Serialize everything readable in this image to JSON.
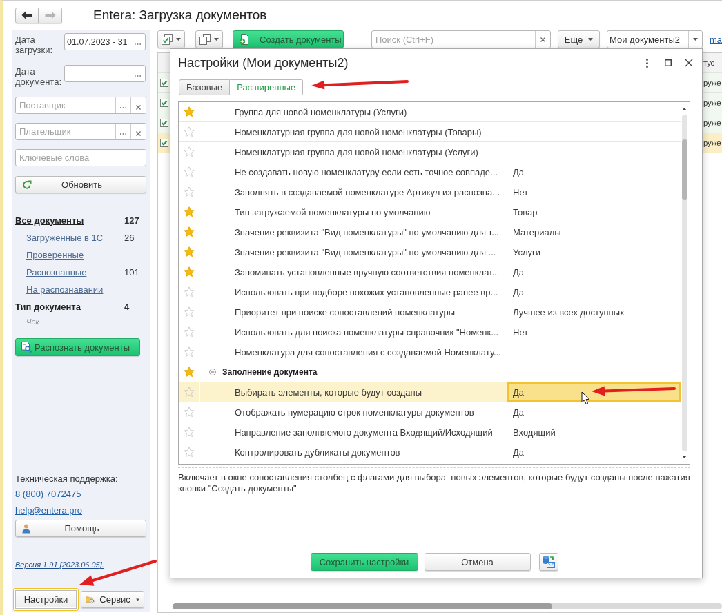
{
  "window": {
    "title": "Entera: Загрузка документов"
  },
  "navigation": {
    "back": {
      "disabled": false
    },
    "forward": {
      "disabled": true
    }
  },
  "filters": {
    "upload_date": {
      "label": "Дата загрузки:",
      "value": "01.07.2023 - 31"
    },
    "document_date": {
      "label": "Дата документа:"
    },
    "supplier": {
      "placeholder": "Поставщик"
    },
    "payer": {
      "placeholder": "Плательщик"
    },
    "keywords": {
      "placeholder": "Ключевые слова"
    },
    "refresh_button": "Обновить"
  },
  "document_groups": [
    {
      "label": "Все документы",
      "count": "127",
      "children": [
        {
          "label": "Загруженные в 1С",
          "count": "26",
          "kind": "link"
        },
        {
          "label": "Проверенные",
          "kind": "link"
        },
        {
          "label": "Распознанные",
          "count": "101",
          "kind": "link"
        },
        {
          "label": "На распознавании",
          "kind": "link"
        }
      ]
    },
    {
      "label": "Тип документа",
      "count": "4",
      "children": [
        {
          "label": "Чек",
          "kind": "note"
        }
      ]
    }
  ],
  "recognize_button": "Распознать документы",
  "support": {
    "label": "Техническая поддержка:",
    "phone": "8 (800) 7072475",
    "email": "help@entera.pro"
  },
  "help_button": "Помощь",
  "version": "Версия 1.91 [2023.06.05].",
  "bottom_buttons": [
    {
      "label": "Настройки",
      "kind": "plain",
      "focused": true
    },
    {
      "label": "Сервис",
      "kind": "menu",
      "focused": false
    }
  ],
  "toolbar": {
    "create_button": "Создать документы",
    "search": {
      "placeholder": "Поиск (Ctrl+F)"
    },
    "more_button": "Еще",
    "view_select": {
      "value": "Мои документы2"
    },
    "link": "ma"
  },
  "document_table": {
    "column_header": "тус",
    "rows": [
      {
        "checked": true,
        "status": "руже",
        "selected": false
      },
      {
        "checked": true,
        "status": "руже",
        "selected": false
      },
      {
        "checked": true,
        "status": "руже",
        "selected": false
      },
      {
        "checked": true,
        "status": "руже",
        "selected": true
      }
    ]
  },
  "dialog": {
    "title": "Настройки (Мои документы2)",
    "tabs": [
      {
        "label": "Базовые",
        "selected": false
      },
      {
        "label": "Расширенные",
        "selected": true
      }
    ],
    "settings": [
      {
        "children": [
          {
            "name": "Группа для новой номенклатуры (Услуги)",
            "starred": true,
            "selected": false
          },
          {
            "name": "Номенклатурная группа для новой номенклатуры (Товары)",
            "starred": false,
            "selected": false
          },
          {
            "name": "Номенклатурная группа для новой номенклатуры (Услуги)",
            "starred": false,
            "selected": false
          },
          {
            "name": "Не создавать новую номенклатуру если есть точное совпаде...",
            "value": "Да",
            "starred": false,
            "selected": false
          },
          {
            "name": "Заполнять в создаваемой номенклатуре Артикул из распозна...",
            "value": "Нет",
            "starred": false,
            "selected": false
          },
          {
            "name": "Тип загружаемой номенклатуры по умолчанию",
            "value": "Товар",
            "starred": true,
            "selected": false
          },
          {
            "name": "Значение реквизита \"Вид номенклатуры\" по умолчанию для т...",
            "value": "Материалы",
            "starred": true,
            "selected": false
          },
          {
            "name": "Значение реквизита \"Вид номенклатуры\" по умолчанию для ...",
            "value": "Услуги",
            "starred": true,
            "selected": false
          },
          {
            "name": "Запоминать установленные вручную соответствия номенклат...",
            "value": "Да",
            "starred": true,
            "selected": false
          },
          {
            "name": "Использовать при подборе похожих установленные ранее вр...",
            "value": "Да",
            "starred": false,
            "selected": false
          },
          {
            "name": "Приоритет при поиске сопоставлений номенклатуры",
            "value": "Лучшее из всех доступных",
            "starred": false,
            "selected": false
          },
          {
            "name": "Использовать для поиска номенклатуры справочник \"Номенк...",
            "value": "Нет",
            "starred": false,
            "selected": false
          },
          {
            "name": "Номенклатура для сопоставления с создаваемой Номенклату...",
            "starred": false,
            "selected": false
          }
        ]
      },
      {
        "title": "Заполнение документа",
        "starred": true,
        "expanded": true,
        "children": [
          {
            "name": "Выбирать элементы, которые будут созданы",
            "value": "Да",
            "starred": false,
            "selected": true
          },
          {
            "name": "Отображать нумерацию строк номенклатуры документов",
            "value": "Да",
            "starred": false,
            "selected": false
          },
          {
            "name": "Направление заполняемого документа Входящий/Исходящий",
            "value": "Входящий",
            "starred": false,
            "selected": false
          },
          {
            "name": "Контролировать дубликаты документов",
            "value": "Да",
            "starred": false,
            "selected": false
          }
        ]
      }
    ],
    "description": "Включает в окне сопоставления столбец с флагами для выбора  новых элементов, которые будут созданы после нажатия кнопки \"Создать документы\"",
    "buttons": [
      {
        "kind": "primary",
        "label": "Сохранить настройки"
      },
      {
        "kind": "secondary",
        "label": "Отмена"
      },
      {
        "kind": "icon"
      }
    ]
  }
}
